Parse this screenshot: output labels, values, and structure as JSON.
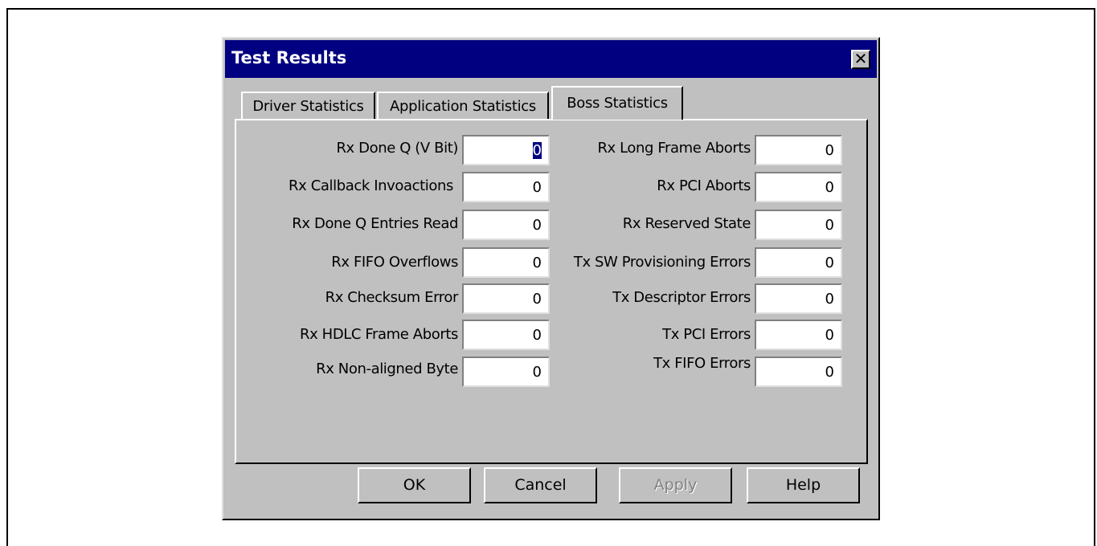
{
  "dialog": {
    "title": "Test Results",
    "close_glyph": "✕"
  },
  "tabs": [
    {
      "label": "Driver Statistics",
      "active": false
    },
    {
      "label": "Application Statistics",
      "active": false
    },
    {
      "label": "Boss Statistics",
      "active": true
    }
  ],
  "left_stats": [
    {
      "label": "Rx Done Q (V Bit)",
      "value": "0"
    },
    {
      "label": "Rx Callback Invoactions",
      "value": "0"
    },
    {
      "label": "Rx Done Q Entries Read",
      "value": "0"
    },
    {
      "label": "Rx FIFO Overflows",
      "value": "0"
    },
    {
      "label": "Rx Checksum Error",
      "value": "0"
    },
    {
      "label": "Rx HDLC Frame Aborts",
      "value": "0"
    },
    {
      "label": "Rx Non-aligned Byte",
      "value": "0"
    }
  ],
  "right_stats": [
    {
      "label": "Rx Long Frame Aborts",
      "value": "0"
    },
    {
      "label": "Rx PCI Aborts",
      "value": "0"
    },
    {
      "label": "Rx Reserved State",
      "value": "0"
    },
    {
      "label": "Tx SW Provisioning Errors",
      "value": "0"
    },
    {
      "label": "Tx Descriptor Errors",
      "value": "0"
    },
    {
      "label": "Tx PCI Errors",
      "value": "0"
    },
    {
      "label": "Tx FIFO Errors",
      "value": "0"
    }
  ],
  "buttons": {
    "ok": "OK",
    "cancel": "Cancel",
    "apply": "Apply",
    "help": "Help"
  },
  "colors": {
    "titlebar": "#000080",
    "face": "#c0c0c0"
  }
}
